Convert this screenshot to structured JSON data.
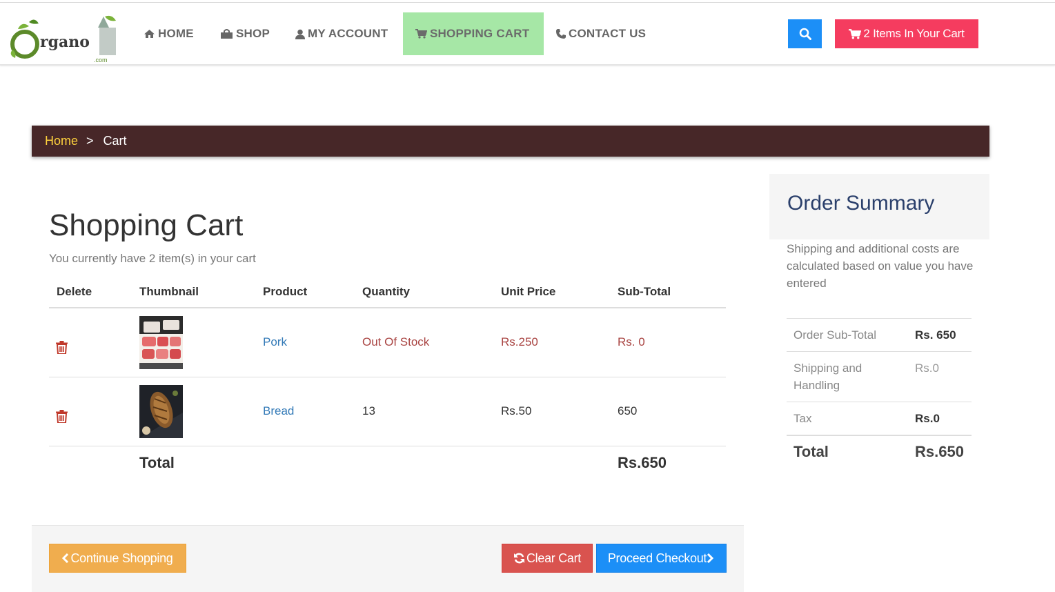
{
  "nav": {
    "logo_text": "rgano",
    "logo_sub": ".com",
    "items": [
      {
        "label": "HOME",
        "icon": "home-icon"
      },
      {
        "label": "SHOP",
        "icon": "shopping-bag-icon"
      },
      {
        "label": "MY ACCOUNT",
        "icon": "user-icon"
      },
      {
        "label": "SHOPPING CART",
        "icon": "shopping-cart-icon",
        "active": true
      },
      {
        "label": "CONTACT US",
        "icon": "phone-icon"
      }
    ],
    "cart_button": "2 Items In Your Cart",
    "accent_colors": {
      "active_tab": "#a6e7a6",
      "search": "#1c8ff7",
      "cart": "#f53c5f"
    }
  },
  "breadcrumb": {
    "home": "Home",
    "separator": ">",
    "current": "Cart"
  },
  "cart": {
    "title": "Shopping Cart",
    "subtitle": "You currently have 2 item(s) in your cart",
    "columns": [
      "Delete",
      "Thumbnail",
      "Product",
      "Quantity",
      "Unit Price",
      "Sub-Total"
    ],
    "rows": [
      {
        "product": "Pork",
        "quantity": "Out Of Stock",
        "unit_price": "Rs.250",
        "subtotal": "Rs. 0",
        "thumbnail": "pork-thumbnail"
      },
      {
        "product": "Bread",
        "quantity": "13",
        "unit_price": "Rs.50",
        "subtotal": "650",
        "thumbnail": "bread-thumbnail"
      }
    ],
    "total_label": "Total",
    "total_value": "Rs.650"
  },
  "buttons": {
    "continue": "Continue Shopping",
    "clear": "Clear Cart",
    "checkout": "Proceed Checkout"
  },
  "summary": {
    "title": "Order Summary",
    "note": "Shipping and additional costs are calculated based on value you have entered",
    "rows": [
      {
        "label": "Order Sub-Total",
        "value": "Rs. 650"
      },
      {
        "label": "Shipping and Handling",
        "value": "Rs.0"
      },
      {
        "label": "Tax",
        "value": "Rs.0"
      }
    ],
    "total_label": "Total",
    "total_value": "Rs.650"
  }
}
